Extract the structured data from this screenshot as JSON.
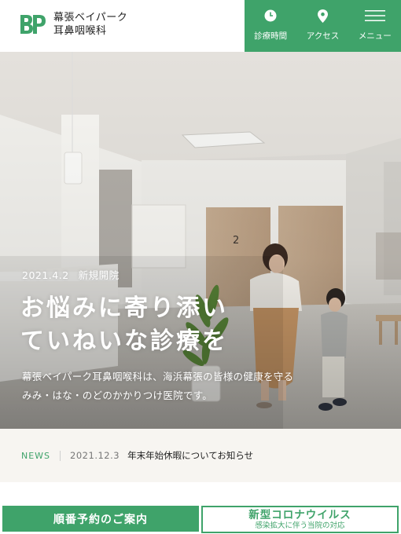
{
  "header": {
    "logo_mark": "BP",
    "clinic_name_line1": "幕張ベイパーク",
    "clinic_name_line2": "耳鼻咽喉科"
  },
  "nav": {
    "hours_label": "診療時間",
    "access_label": "アクセス",
    "menu_label": "メニュー"
  },
  "hero": {
    "date": "2021.4.2",
    "tag": "新規開院",
    "title_line1": "お悩みに寄り添い",
    "title_line2": "ていねいな診療を",
    "desc_line1": "幕張ベイパーク耳鼻咽喉科は、海浜幕張の皆様の健康を守る",
    "desc_line2": "みみ・はな・のどのかかりつけ医院です。",
    "room_number": "2"
  },
  "news": {
    "label": "NEWS",
    "date": "2021.12.3",
    "title": "年末年始休暇についてお知らせ"
  },
  "buttons": {
    "reserve_label": "順番予約のご案内",
    "corona_main": "新型コロナウイルス",
    "corona_sub": "感染拡大に伴う当院の対応"
  },
  "colors": {
    "brand_green": "#3fa36a",
    "news_bg": "#f7f5f1"
  }
}
